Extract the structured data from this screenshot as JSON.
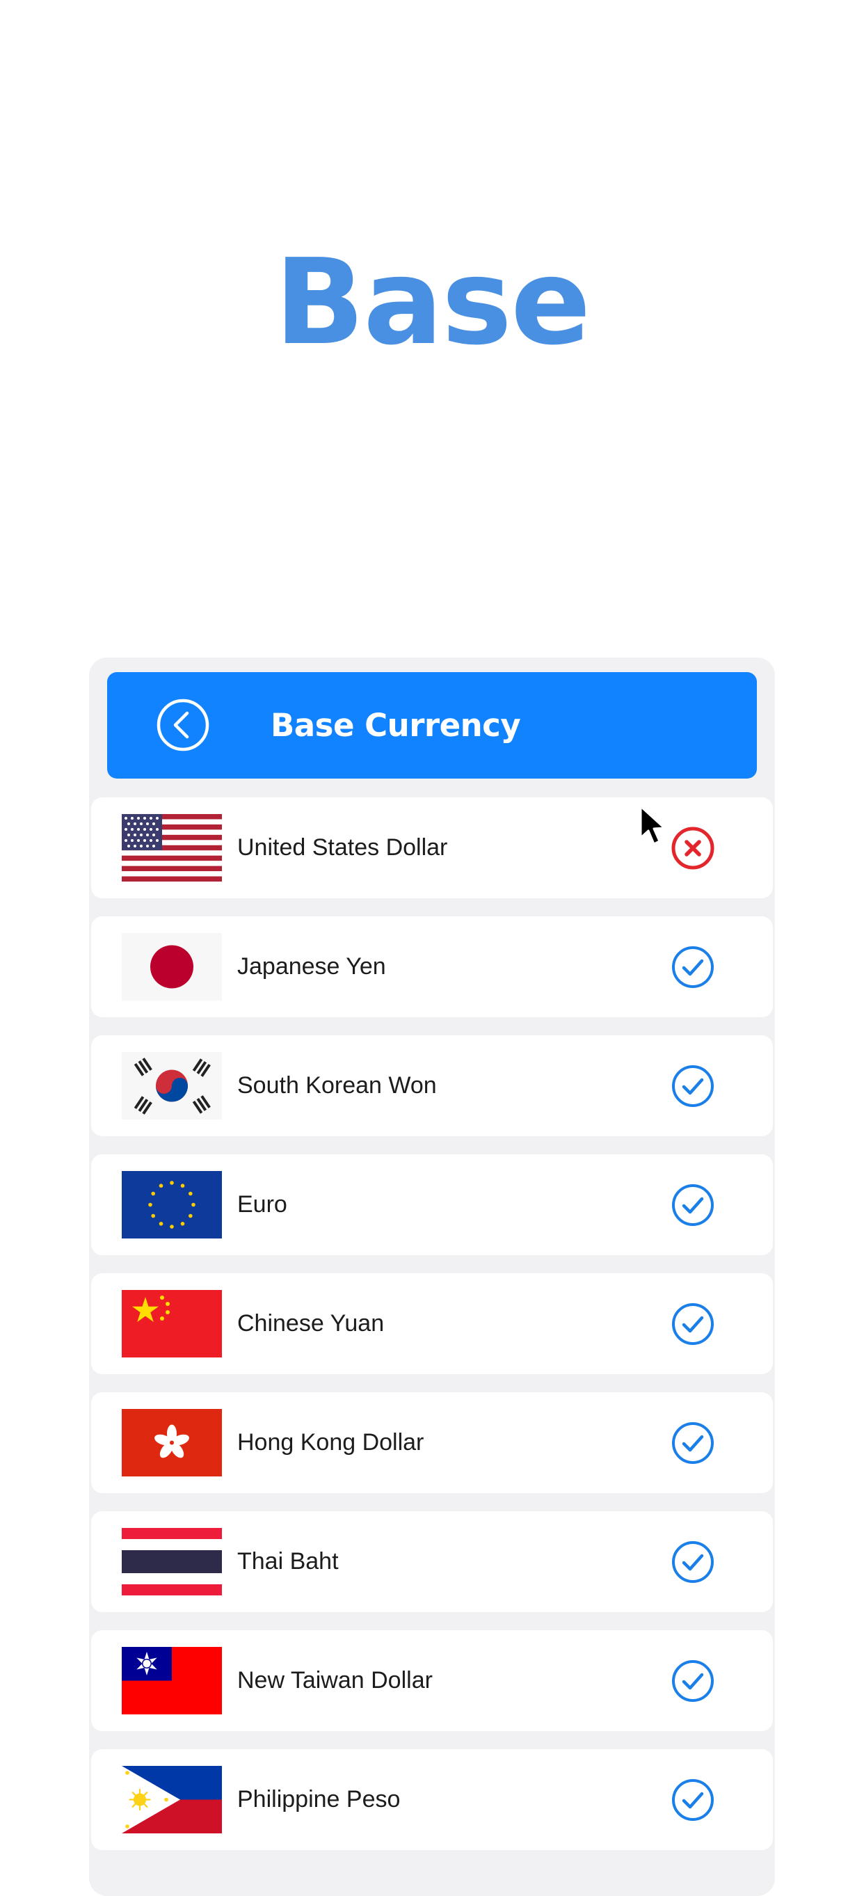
{
  "hero": {
    "title": "Base",
    "color": "#4a90e2"
  },
  "nav": {
    "title": "Base Currency",
    "back_icon": "chevron-left-circle-icon",
    "color": "#1283ff"
  },
  "colors": {
    "selected_check": "#1a7fe8",
    "remove": "#e3262c",
    "row_background": "#ffffff",
    "panel_background": "#f1f1f3"
  },
  "currencies": [
    {
      "name": "United States Dollar",
      "flag": "us-flag",
      "status": "remove"
    },
    {
      "name": "Japanese Yen",
      "flag": "japan-flag",
      "status": "selected"
    },
    {
      "name": "South Korean Won",
      "flag": "south-korea-flag",
      "status": "selected"
    },
    {
      "name": "Euro",
      "flag": "eu-flag",
      "status": "selected"
    },
    {
      "name": "Chinese Yuan",
      "flag": "china-flag",
      "status": "selected"
    },
    {
      "name": "Hong Kong Dollar",
      "flag": "hong-kong-flag",
      "status": "selected"
    },
    {
      "name": "Thai Baht",
      "flag": "thailand-flag",
      "status": "selected"
    },
    {
      "name": "New Taiwan Dollar",
      "flag": "taiwan-flag",
      "status": "selected"
    },
    {
      "name": "Philippine Peso",
      "flag": "philippines-flag",
      "status": "selected"
    }
  ]
}
